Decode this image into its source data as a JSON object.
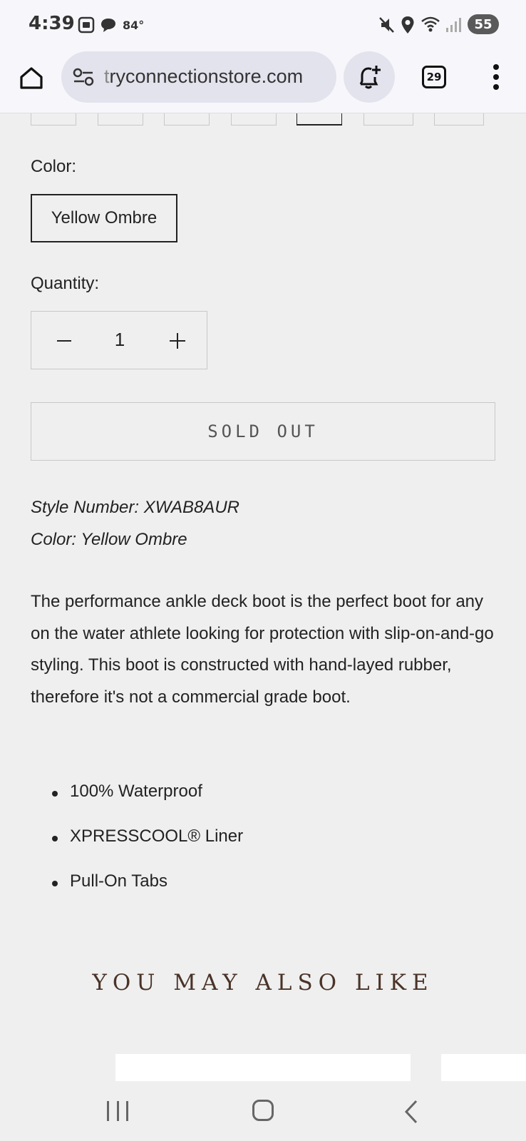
{
  "status_bar": {
    "time": "4:39",
    "temperature": "84°",
    "battery": "55"
  },
  "browser": {
    "url_prefix": "t",
    "url_rest": "ryconnectionstore.com",
    "tab_count": "29"
  },
  "product": {
    "size_selected_index": 4,
    "color_label": "Color:",
    "color_option": "Yellow Ombre",
    "quantity_label": "Quantity:",
    "quantity_value": "1",
    "sold_out_label": "SOLD OUT",
    "style_number": "Style Number: XWAB8AUR",
    "color_line": "Color: Yellow Ombre",
    "description": "The performance ankle deck boot is the perfect boot for any on the water athlete looking for protection with slip-on-and-go styling. This boot is constructed with hand-layed rubber, therefore it's not a commercial grade boot.",
    "features": [
      "100% Waterproof",
      "XPRESSCOOL® Liner",
      "Pull-On Tabs"
    ]
  },
  "recommendations": {
    "title": "YOU MAY ALSO LIKE"
  },
  "icons": {
    "home": "home-icon",
    "tune": "tune-icon",
    "notification_add": "notification-add-icon",
    "menu": "more-vert-icon"
  }
}
